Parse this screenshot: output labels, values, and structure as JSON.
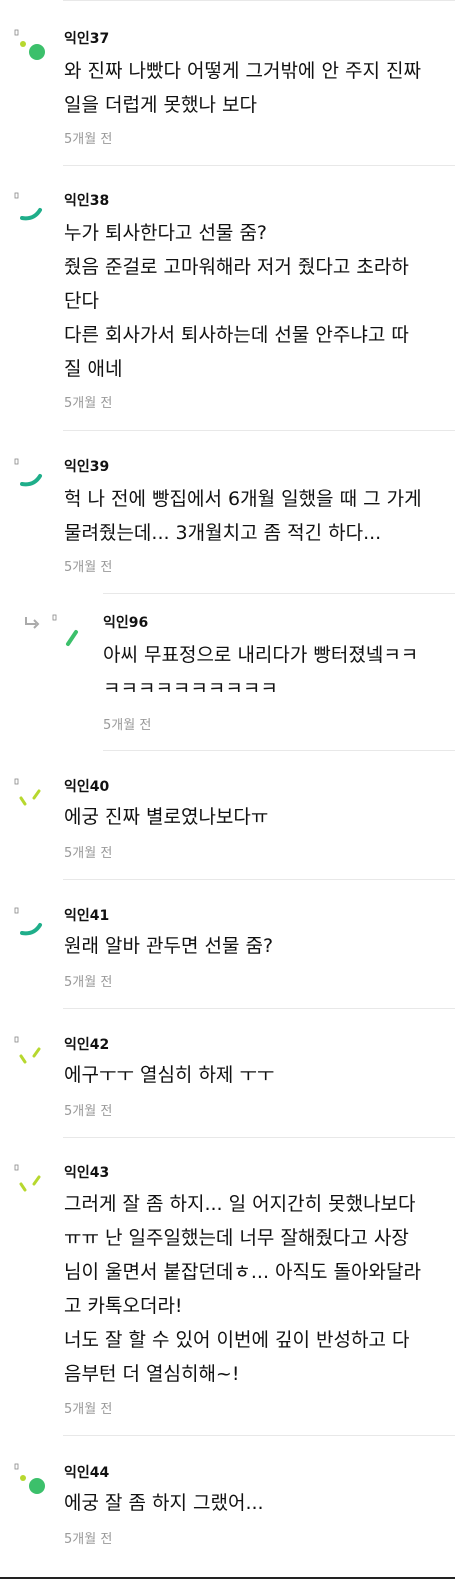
{
  "comments": [
    {
      "name": "익인37",
      "lines": [
        "와 진짜 나빴다 어떻게 그거밖에 안 주지 진짜",
        "일을 더럽게 못했나 보다"
      ],
      "time": "5개월 전",
      "avatar": "dot-green-icon"
    },
    {
      "name": "익인38",
      "lines": [
        "누가 퇴사한다고 선물 줌?",
        "줬음 준걸로 고마워해라 저거 줬다고 초라하",
        "단다",
        "다른 회사가서 퇴사하는데 선물 안주냐고 따",
        "질 애네"
      ],
      "time": "5개월 전",
      "avatar": "arc-teal-icon"
    },
    {
      "name": "익인39",
      "lines": [
        "헉 나 전에 빵집에서 6개월 일했을 때 그 가게",
        "물려줬는데... 3개월치고 좀 적긴 하다..."
      ],
      "time": "5개월 전",
      "avatar": "arc-teal-icon"
    },
    {
      "name": "익인96",
      "lines": [
        "아씨 무표정으로 내리다가 빵터졌넼ㅋㅋ",
        "ㅋㅋㅋㅋㅋㅋㅋㅋㅋㅋ"
      ],
      "time": "5개월 전",
      "avatar": "slash-green-icon",
      "reply": true
    },
    {
      "name": "익인40",
      "lines": [
        "에궁 진짜 별로였나보다ㅠ"
      ],
      "time": "5개월 전",
      "avatar": "ticks-lime-icon"
    },
    {
      "name": "익인41",
      "lines": [
        "원래 알바 관두면 선물 줌?"
      ],
      "time": "5개월 전",
      "avatar": "arc-teal-icon"
    },
    {
      "name": "익인42",
      "lines": [
        "에구ㅜㅜ 열심히 하제 ㅜㅜ"
      ],
      "time": "5개월 전",
      "avatar": "ticks-lime-icon"
    },
    {
      "name": "익인43",
      "lines": [
        "그러게 잘 좀 하지... 일 어지간히 못했나보다",
        "ㅠㅠ 난 일주일했는데 너무 잘해줬다고 사장",
        "님이 울면서 붙잡던데ㅎ... 아직도 돌아와달라",
        "고 카톡오더라!",
        "너도 잘 할 수 있어 이번에 깊이 반성하고 다",
        "음부턴 더 열심히해~!"
      ],
      "time": "5개월 전",
      "avatar": "ticks-lime-icon"
    },
    {
      "name": "익인44",
      "lines": [
        "에궁 잘 좀 하지 그랬어..."
      ],
      "time": "5개월 전",
      "avatar": "dot-green-icon"
    }
  ],
  "colors": {
    "accent_green": "#3cc06b",
    "accent_teal": "#1fae8a",
    "accent_lime": "#b7d82f",
    "meta_gray": "#9a9a9a"
  }
}
